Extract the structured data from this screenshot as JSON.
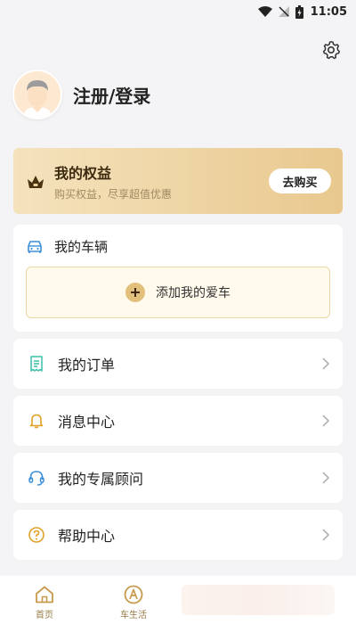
{
  "status_bar": {
    "time": "11:05"
  },
  "profile": {
    "login_text": "注册/登录"
  },
  "rights": {
    "title": "我的权益",
    "subtitle": "购买权益，尽享超值优惠",
    "buy_label": "去购买"
  },
  "vehicles": {
    "title": "我的车辆",
    "add_label": "添加我的爱车"
  },
  "menu": [
    {
      "label": "我的订单",
      "icon": "receipt-icon"
    },
    {
      "label": "消息中心",
      "icon": "bell-icon"
    },
    {
      "label": "我的专属顾问",
      "icon": "headset-icon"
    },
    {
      "label": "帮助中心",
      "icon": "help-icon"
    }
  ],
  "tabs": [
    {
      "label": "首页",
      "icon": "home-icon"
    },
    {
      "label": "车生活",
      "icon": "car-life-icon"
    }
  ],
  "colors": {
    "accent": "#d89a2c",
    "gold": "#e2bf7a",
    "teal": "#3bbfa8",
    "blue": "#3b8fd8"
  }
}
